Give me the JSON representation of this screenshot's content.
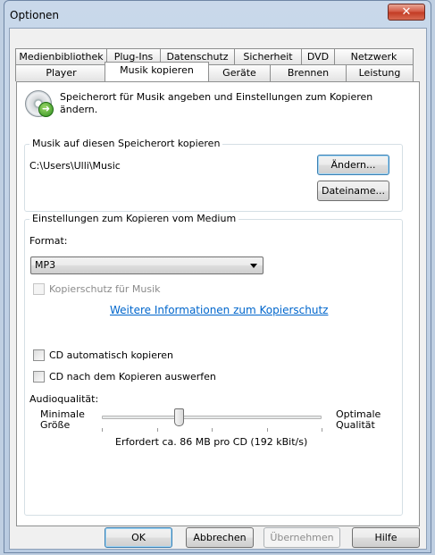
{
  "window": {
    "title": "Optionen",
    "close_glyph": "✕"
  },
  "tabs_row1": [
    "Medienbibliothek",
    "Plug-Ins",
    "Datenschutz",
    "Sicherheit",
    "DVD",
    "Netzwerk"
  ],
  "tabs_row2": [
    "Player",
    "Musik kopieren",
    "Geräte",
    "Brennen",
    "Leistung"
  ],
  "intro": "Speicherort für Musik angeben und Einstellungen zum Kopieren ändern.",
  "location": {
    "group_title": "Musik auf diesen Speicherort kopieren",
    "path": "C:\\Users\\Ulli\\Music",
    "change_button": "Ändern...",
    "filename_button": "Dateiname..."
  },
  "rip": {
    "group_title": "Einstellungen zum Kopieren vom Medium",
    "format_label": "Format:",
    "format_value": "MP3",
    "copy_protect_label": "Kopierschutz für Musik",
    "copy_protect_link": "Weitere Informationen zum Kopierschutz",
    "auto_rip_label": "CD automatisch kopieren",
    "eject_label": "CD nach dem Kopieren auswerfen",
    "audio_quality_label": "Audioqualität:",
    "min_label_1": "Minimale",
    "min_label_2": "Größe",
    "max_label_1": "Optimale",
    "max_label_2": "Qualität",
    "slider_level": 0.35,
    "requirement_text": "Erfordert ca. 86 MB pro CD (192 kBit/s)"
  },
  "footer": {
    "ok": "OK",
    "cancel": "Abbrechen",
    "apply": "Übernehmen",
    "help": "Hilfe"
  }
}
